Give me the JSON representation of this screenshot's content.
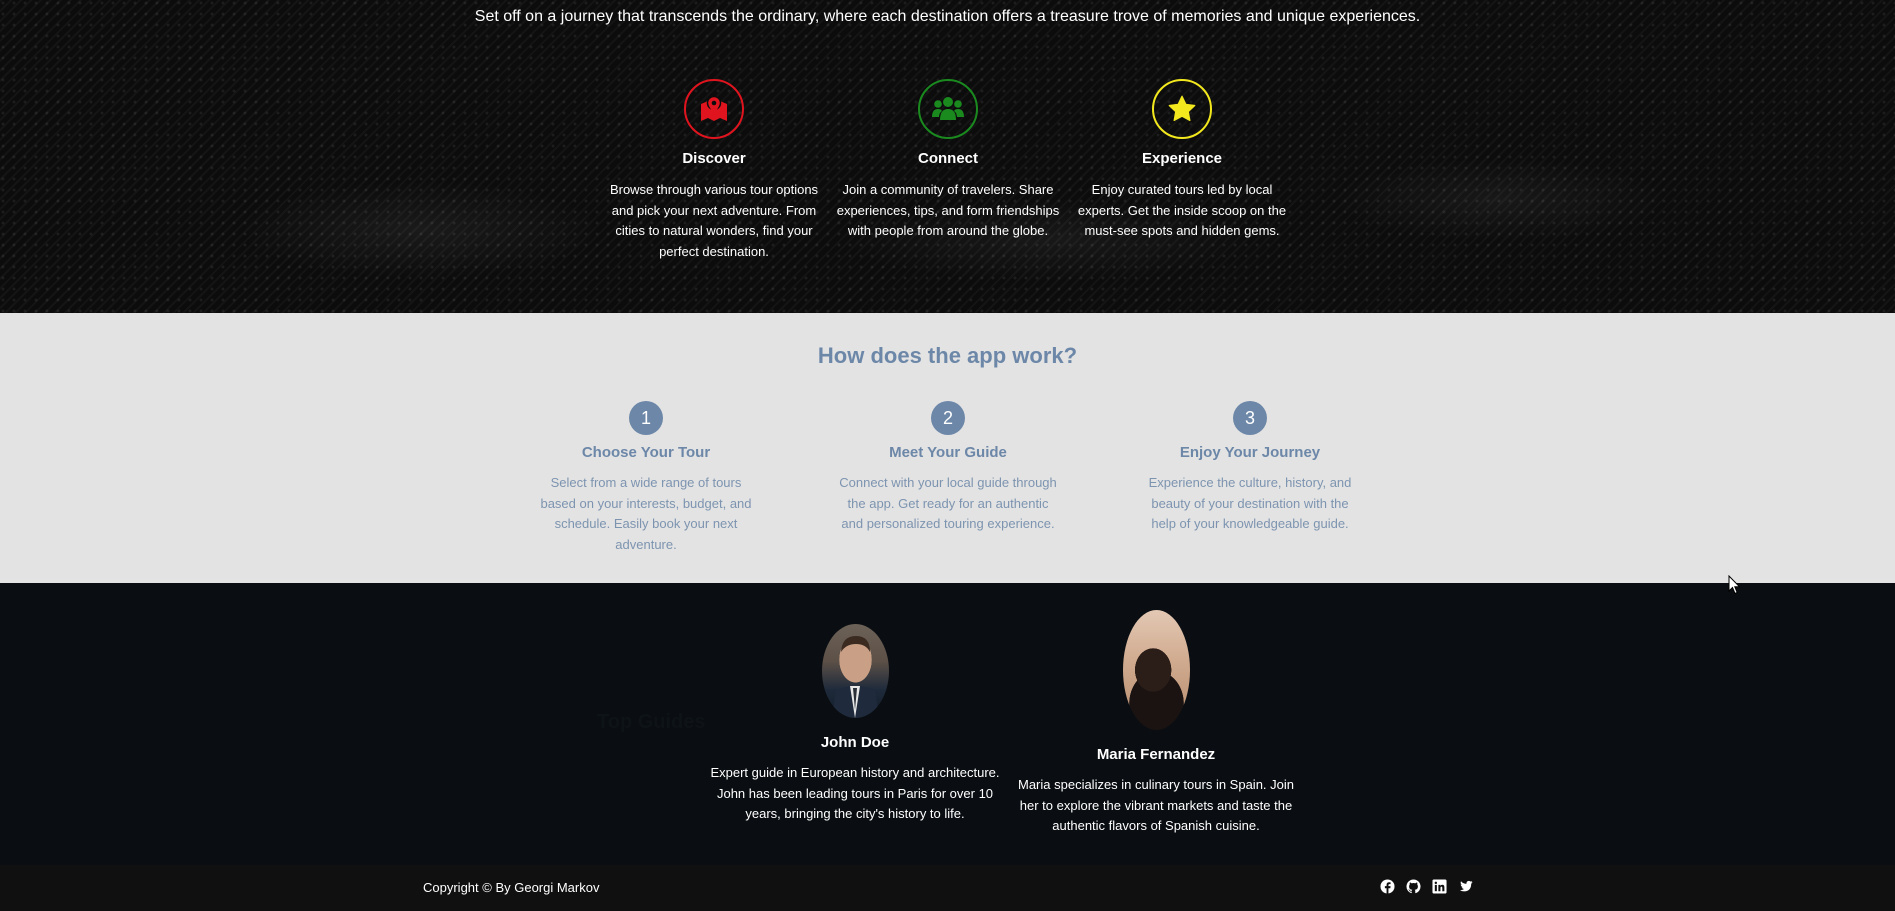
{
  "hero": {
    "intro": "Set off on a journey that transcends the ordinary, where each destination offers a treasure trove of memories and unique experiences.",
    "features": [
      {
        "title": "Discover",
        "icon": "map-location-icon",
        "color": "#e0141e",
        "description": "Browse through various tour options and pick your next adventure. From cities to natural wonders, find your perfect destination."
      },
      {
        "title": "Connect",
        "icon": "people-group-icon",
        "color": "#1a8a1f",
        "description": "Join a community of travelers. Share experiences, tips, and form friendships with people from around the globe."
      },
      {
        "title": "Experience",
        "icon": "star-icon",
        "color": "#f2e81d",
        "description": "Enjoy curated tours led by local experts. Get the inside scoop on the must-see spots and hidden gems."
      }
    ]
  },
  "how": {
    "heading": "How does the app work?",
    "steps": [
      {
        "number": "1",
        "title": "Choose Your Tour",
        "description": "Select from a wide range of tours based on your interests, budget, and schedule. Easily book your next adventure."
      },
      {
        "number": "2",
        "title": "Meet Your Guide",
        "description": "Connect with your local guide through the app. Get ready for an authentic and personalized touring experience."
      },
      {
        "number": "3",
        "title": "Enjoy Your Journey",
        "description": "Experience the culture, history, and beauty of your destination with the help of your knowledgeable guide."
      }
    ]
  },
  "guides": {
    "heading": "Top Guides",
    "items": [
      {
        "name": "John Doe",
        "description": "Expert guide in European history and architecture. John has been leading tours in Paris for over 10 years, bringing the city's history to life."
      },
      {
        "name": "Maria Fernandez",
        "description": "Maria specializes in culinary tours in Spain. Join her to explore the vibrant markets and taste the authentic flavors of Spanish cuisine."
      }
    ]
  },
  "footer": {
    "copyright": "Copyright © By Georgi Markov",
    "socials": [
      "facebook-icon",
      "github-icon",
      "linkedin-icon",
      "twitter-icon"
    ]
  },
  "colors": {
    "accent": "#6c87a8",
    "discover": "#e0141e",
    "connect": "#1a8a1f",
    "experience": "#f2e81d"
  }
}
